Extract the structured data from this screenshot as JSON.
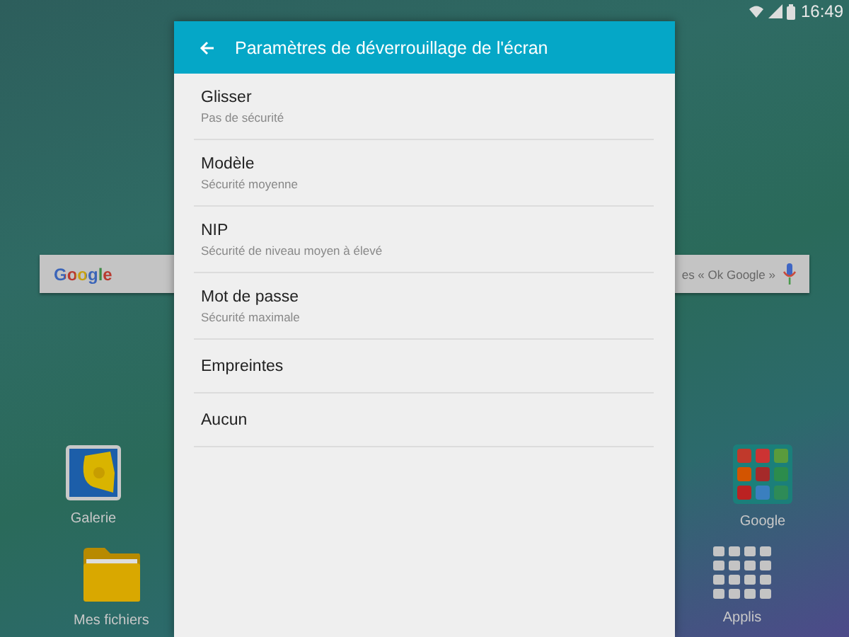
{
  "status_bar": {
    "time": "16:49"
  },
  "search_bar": {
    "logo": "Google",
    "hint": "es « Ok Google »"
  },
  "home_rows": [
    {
      "items": [
        {
          "label": "Galerie",
          "kind": "gallery"
        },
        {
          "label": "Google",
          "kind": "app_folder"
        }
      ]
    },
    {
      "items": [
        {
          "label": "Mes fichiers",
          "kind": "folder"
        },
        {
          "label": "Applis",
          "kind": "apps_grid"
        }
      ]
    }
  ],
  "dialog": {
    "title": "Paramètres de déverrouillage de l'écran",
    "options": [
      {
        "title": "Glisser",
        "subtitle": "Pas de sécurité"
      },
      {
        "title": "Modèle",
        "subtitle": "Sécurité moyenne"
      },
      {
        "title": "NIP",
        "subtitle": "Sécurité de niveau moyen à élevé"
      },
      {
        "title": "Mot de passe",
        "subtitle": "Sécurité maximale"
      },
      {
        "title": "Empreintes"
      },
      {
        "title": "Aucun"
      }
    ]
  }
}
